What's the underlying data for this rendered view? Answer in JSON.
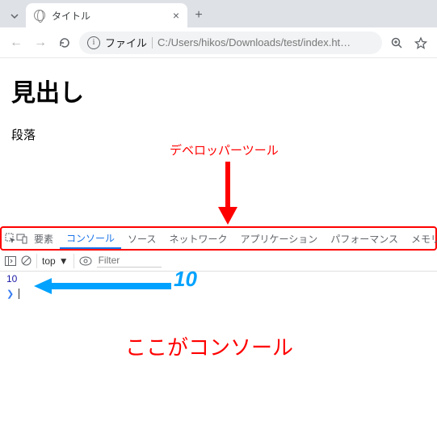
{
  "browser": {
    "tab_title": "タイトル",
    "protocol_label": "ファイル",
    "url_path": "C:/Users/hikos/Downloads/test/index.ht…"
  },
  "page": {
    "heading": "見出し",
    "paragraph": "段落"
  },
  "annotations": {
    "devtools_label": "デベロッパーツール",
    "big_ten": "10",
    "console_here": "ここがコンソール"
  },
  "devtools": {
    "tabs": {
      "elements": "要素",
      "console": "コンソール",
      "sources": "ソース",
      "network": "ネットワーク",
      "application": "アプリケーション",
      "performance": "パフォーマンス",
      "memory": "メモリ"
    },
    "toolbar": {
      "context": "top",
      "filter_placeholder": "Filter"
    },
    "log_value": "10"
  }
}
